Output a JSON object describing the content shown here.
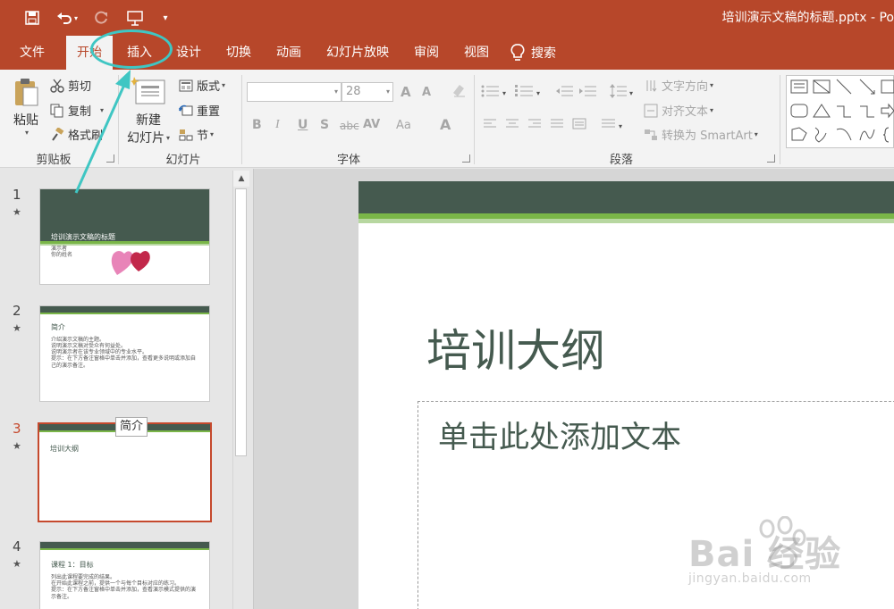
{
  "title_bar": {
    "doc_title": "培训演示文稿的标题.pptx - Po",
    "qat_icons": [
      "save-icon",
      "undo-icon",
      "redo-icon",
      "present-icon",
      "customize-icon"
    ]
  },
  "tabs": [
    {
      "label": "文件"
    },
    {
      "label": "开始"
    },
    {
      "label": "插入"
    },
    {
      "label": "设计"
    },
    {
      "label": "切换"
    },
    {
      "label": "动画"
    },
    {
      "label": "幻灯片放映"
    },
    {
      "label": "审阅"
    },
    {
      "label": "视图"
    }
  ],
  "tell_me": {
    "label": "搜索"
  },
  "ribbon": {
    "clipboard": {
      "paste": "粘贴",
      "cut": "剪切",
      "copy": "复制",
      "format_painter": "格式刷",
      "group_label": "剪贴板"
    },
    "slides": {
      "new_slide_line1": "新建",
      "new_slide_line2": "幻灯片",
      "layout": "版式",
      "reset": "重置",
      "section": "节",
      "group_label": "幻灯片"
    },
    "font": {
      "font_name": "",
      "font_size": "28",
      "bold": "B",
      "italic": "I",
      "underline": "U",
      "shadow": "S",
      "strike": "abc",
      "spacing": "AV",
      "case": "Aa",
      "color": "A",
      "grow": "A",
      "shrink": "A",
      "group_label": "字体"
    },
    "paragraph": {
      "text_direction": "文字方向",
      "align_text": "对齐文本",
      "smartart": "转换为 SmartArt",
      "group_label": "段落"
    }
  },
  "slides": [
    {
      "number": "1",
      "title": "培训演示文稿的标题",
      "line1": "演示者",
      "line2": "你的姓名"
    },
    {
      "number": "2",
      "title": "简介",
      "bullets": [
        "介绍演示文稿的主题。",
        "说明演示文稿对受众有何益处。",
        "说明演示者在该专业领域中的专业水平。",
        "提示：在下方备注窗格中单击并添加，查看更多说明或添加自己的演示备注。"
      ]
    },
    {
      "number": "3",
      "title": "培训大纲"
    },
    {
      "number": "4",
      "title": "课程 1：目标",
      "bullets": [
        "列出此课程要完成的结果。",
        "在开始此课程之前，提供一个与每个目标对应的练习。",
        "提示：在下方备注窗格中单击并添加，查看演示模式提供的演示备注。"
      ]
    }
  ],
  "thumb_star": "★",
  "tooltip": "简介",
  "editor": {
    "slide_title": "培训大纲",
    "body_placeholder": "单击此处添加文本"
  },
  "watermark": {
    "main": "Bai  经验",
    "sub": "jingyan.baidu.com"
  },
  "colors": {
    "brand": "#b7472a",
    "slide_dark": "#455a4f",
    "slide_green": "#7ab648",
    "selection": "#c5492d",
    "annotation": "#3fc6c3"
  }
}
